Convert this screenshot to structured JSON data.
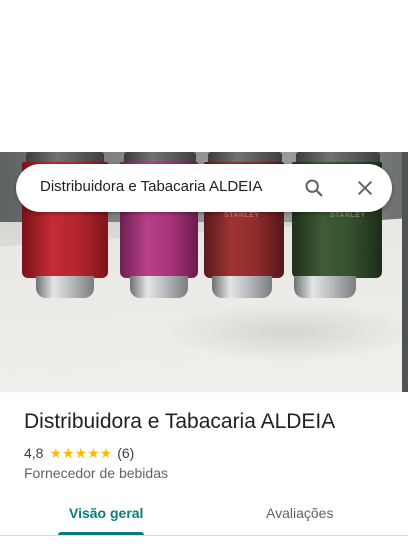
{
  "search": {
    "query": "Distribuidora e Tabacaria ALDEIA",
    "search_icon": "search-icon",
    "clear_icon": "close-icon"
  },
  "photo": {
    "cup_brand": "STANLEY",
    "cup_colors": [
      "#b3262f",
      "#a8347a",
      "#8e2c2c",
      "#35502d"
    ]
  },
  "place": {
    "title": "Distribuidora e Tabacaria ALDEIA",
    "rating": "4,8",
    "stars": "★★★★★",
    "review_count": "(6)",
    "category": "Fornecedor de bebidas"
  },
  "tabs": [
    {
      "label": "Visão geral",
      "active": true
    },
    {
      "label": "Avaliações",
      "active": false
    }
  ],
  "colors": {
    "accent": "#0b7d7a",
    "star": "#fbbc04"
  }
}
